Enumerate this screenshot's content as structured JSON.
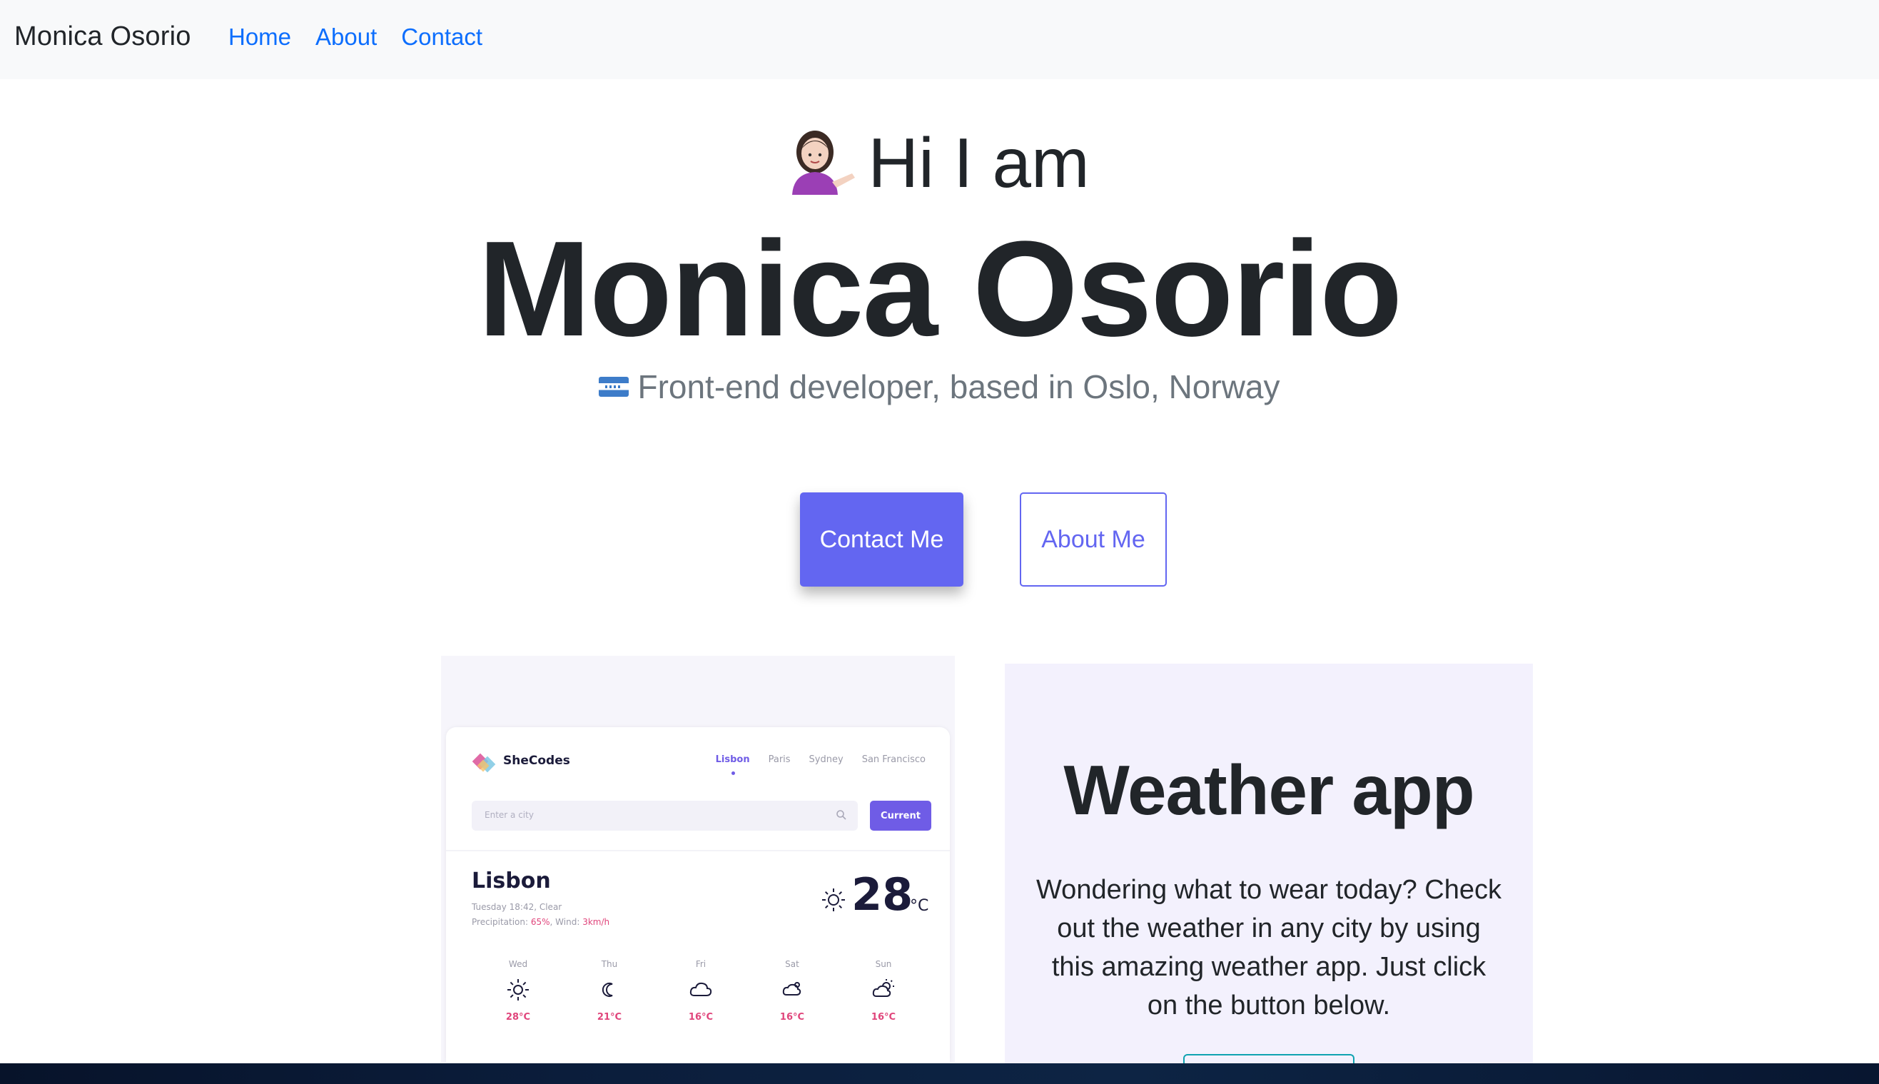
{
  "navbar": {
    "brand": "Monica Osorio",
    "links": [
      "Home",
      "About",
      "Contact"
    ]
  },
  "hero": {
    "greeting": "Hi I am",
    "greeting_emoji": "person-tipping-hand",
    "name": "Monica Osorio",
    "tagline": "Front-end developer, based in Oslo, Norway",
    "tagline_flag": "honduras-flag"
  },
  "buttons": {
    "contact": "Contact Me",
    "about": "About Me"
  },
  "project": {
    "title": "Weather app",
    "description": "Wondering what to wear today? Check out the weather in any city by using this amazing weather app. Just click on the button below."
  },
  "preview": {
    "brand": "SheCodes",
    "tabs": [
      "Lisbon",
      "Paris",
      "Sydney",
      "San Francisco"
    ],
    "active_tab": "Lisbon",
    "search_placeholder": "Enter a city",
    "current_label": "Current",
    "city": "Lisbon",
    "date": "Tuesday 18:42, Clear",
    "precip_label": "Precipitation: ",
    "precip_value": "65%",
    "wind_label": ", Wind: ",
    "wind_value": "3km/h",
    "temperature": "28",
    "unit": "°C",
    "forecast": [
      {
        "day": "Wed",
        "icon": "sun-icon",
        "temp": "28°C"
      },
      {
        "day": "Thu",
        "icon": "moon-icon",
        "temp": "21°C"
      },
      {
        "day": "Fri",
        "icon": "cloud-icon",
        "temp": "16°C"
      },
      {
        "day": "Sat",
        "icon": "rain-cloud-icon",
        "temp": "16°C"
      },
      {
        "day": "Sun",
        "icon": "partly-cloudy-icon",
        "temp": "16°C"
      }
    ]
  },
  "colors": {
    "accent": "#6366f1",
    "link": "#0d6efd",
    "card_bg": "#f3f1fd"
  }
}
